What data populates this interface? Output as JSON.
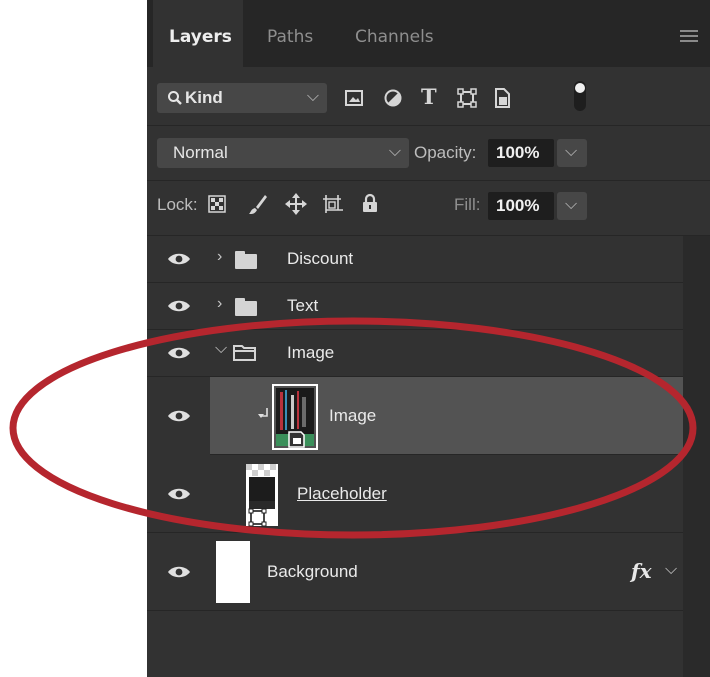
{
  "tabs": [
    "Layers",
    "Paths",
    "Channels"
  ],
  "filter": {
    "label": "Kind"
  },
  "blend": {
    "mode": "Normal",
    "opacity_label": "Opacity:",
    "opacity": "100%"
  },
  "lock": {
    "label": "Lock:",
    "fill_label": "Fill:",
    "fill": "100%"
  },
  "layers": [
    {
      "name": "Discount",
      "type": "group"
    },
    {
      "name": "Text",
      "type": "group"
    },
    {
      "name": "Image",
      "type": "group-open"
    },
    {
      "name": "Image",
      "type": "smart-object-clipped"
    },
    {
      "name": "Placeholder",
      "type": "frame"
    },
    {
      "name": "Background",
      "type": "pixel",
      "effects": "fx"
    }
  ],
  "colors": {
    "panel": "#323232",
    "tabbar": "#262626",
    "selected_row": "#535353",
    "annotation_oval": "#b5262e"
  }
}
